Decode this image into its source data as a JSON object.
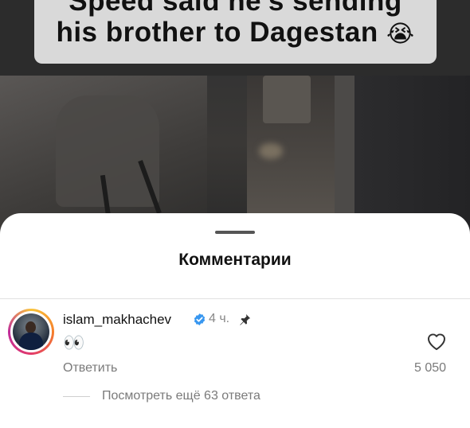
{
  "video": {
    "caption_line1": "Speed said he's sending",
    "caption_line2": "his brother to Dagestan",
    "caption_emoji": "😭"
  },
  "comments_sheet": {
    "title": "Комментарии"
  },
  "comment": {
    "username": "islam_makhachev",
    "verified_icon": "verified-badge-icon",
    "time": "4 ч.",
    "pin_icon": "pin-icon",
    "text": "👀",
    "reply_label": "Ответить",
    "like_icon": "heart-icon",
    "likes_count": "5 050",
    "view_more_replies": "Посмотреть ещё 63 ответа"
  },
  "colors": {
    "verified_blue": "#3897f0",
    "secondary_text": "#7a7a7a",
    "sheet_background": "#ffffff"
  }
}
